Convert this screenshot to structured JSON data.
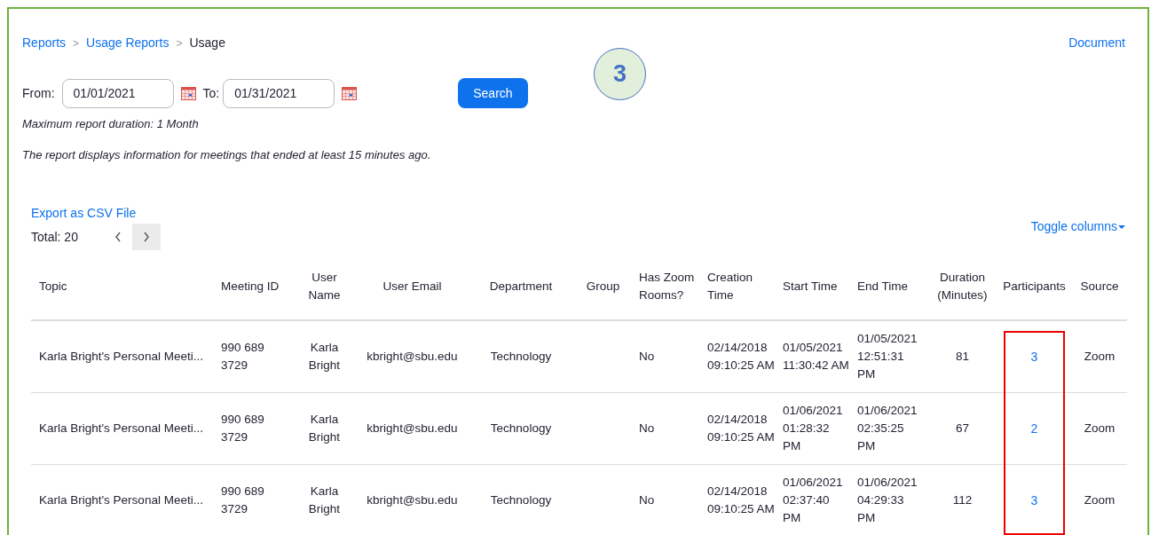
{
  "breadcrumb": [
    {
      "label": "Reports",
      "kind": "link"
    },
    {
      "label": ">",
      "kind": "separator"
    },
    {
      "label": "Usage Reports",
      "kind": "link"
    },
    {
      "label": ">",
      "kind": "separator"
    },
    {
      "label": "Usage",
      "kind": "current"
    }
  ],
  "document_link": "Document",
  "step_badge": "3",
  "filters": {
    "from_label": "From:",
    "from_value": "01/01/2021",
    "to_label": "To:",
    "to_value": "01/31/2021",
    "search_button": "Search"
  },
  "notes": [
    "Maximum report duration: 1 Month",
    "The report displays information for meetings that ended at least 15 minutes ago."
  ],
  "export_link": "Export as CSV File",
  "total": "Total: 20",
  "toggle_columns": "Toggle columns",
  "table": {
    "columns": [
      {
        "label": "Topic",
        "highlighted": false
      },
      {
        "label": "Meeting ID",
        "highlighted": false
      },
      {
        "label": "User Name",
        "highlighted": false
      },
      {
        "label": "User Email",
        "highlighted": false
      },
      {
        "label": "Department",
        "highlighted": false
      },
      {
        "label": "Group",
        "highlighted": false
      },
      {
        "label": "Has Zoom Rooms?",
        "highlighted": false
      },
      {
        "label": "Creation Time",
        "highlighted": false
      },
      {
        "label": "Start Time",
        "highlighted": false
      },
      {
        "label": "End Time",
        "highlighted": false
      },
      {
        "label": "Duration (Minutes)",
        "highlighted": false
      },
      {
        "label": "Participants",
        "highlighted": true
      },
      {
        "label": "Source",
        "highlighted": false
      }
    ],
    "rows": [
      [
        "Karla Bright's Personal Meeti...",
        "990 689 3729",
        "Karla Bright",
        "kbright@sbu.edu",
        "Technology",
        "",
        "No",
        "02/14/2018 09:10:25 AM",
        "01/05/2021 11:30:42 AM",
        "01/05/2021 12:51:31 PM",
        "81",
        "3",
        "Zoom"
      ],
      [
        "Karla Bright's Personal Meeti...",
        "990 689 3729",
        "Karla Bright",
        "kbright@sbu.edu",
        "Technology",
        "",
        "No",
        "02/14/2018 09:10:25 AM",
        "01/06/2021 01:28:32 PM",
        "01/06/2021 02:35:25 PM",
        "67",
        "2",
        "Zoom"
      ],
      [
        "Karla Bright's Personal Meeti...",
        "990 689 3729",
        "Karla Bright",
        "kbright@sbu.edu",
        "Technology",
        "",
        "No",
        "02/14/2018 09:10:25 AM",
        "01/06/2021 02:37:40 PM",
        "01/06/2021 04:29:33 PM",
        "112",
        "3",
        "Zoom"
      ]
    ]
  }
}
